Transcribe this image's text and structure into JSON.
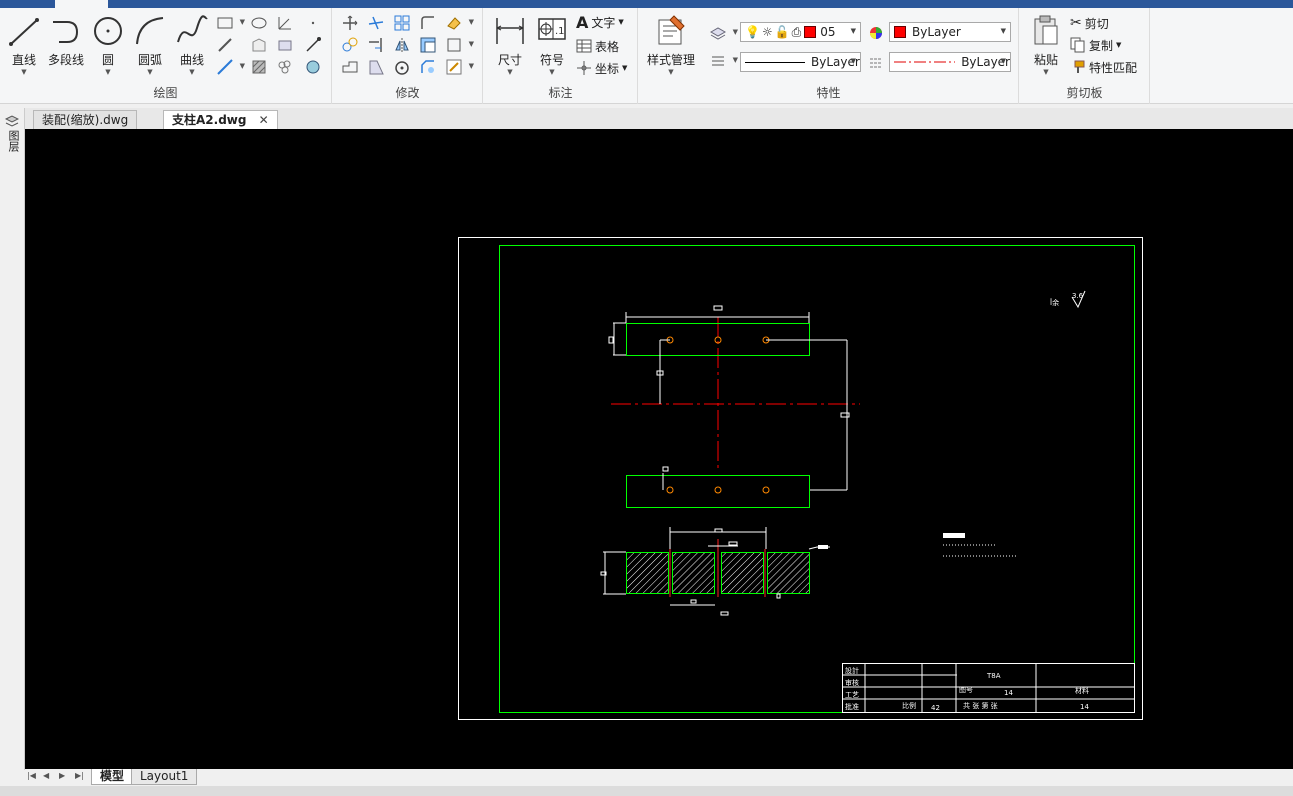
{
  "ribbon": {
    "draw": {
      "title": "绘图",
      "line": "直线",
      "polyline": "多段线",
      "circle": "圆",
      "arc": "圆弧",
      "spline": "曲线"
    },
    "modify": {
      "title": "修改"
    },
    "annotate": {
      "title": "标注",
      "dimension": "尺寸",
      "symbol": "符号",
      "text": "文字",
      "table": "表格",
      "coordinate": "坐标"
    },
    "properties": {
      "title": "特性",
      "style_manager": "样式管理",
      "layer_name": "05",
      "color_value": "ByLayer",
      "linetype_value": "ByLayer",
      "lineweight_value": "ByLayer"
    },
    "clipboard": {
      "title": "剪切板",
      "paste": "粘贴",
      "cut": "剪切",
      "copy": "复制",
      "match_properties": "特性匹配"
    }
  },
  "left_panel": {
    "label": "图层"
  },
  "doc_tabs": [
    {
      "label": "装配(缩放).dwg"
    },
    {
      "label": "支柱A2.dwg",
      "close": "✕"
    }
  ],
  "layout_tabs": [
    {
      "label": "模型"
    },
    {
      "label": "Layout1"
    }
  ],
  "drawing": {
    "title_block": {
      "material": "T8A",
      "c1": "14",
      "c2": "14",
      "c3": "42"
    }
  },
  "colors": {
    "ribbon_accent": "#2b579a",
    "canvas_bg": "#000000",
    "frame": "#ffffff",
    "border_green": "#00ff00",
    "centerline": "#ff0000",
    "hatch_fill": "#00aa00",
    "layer_color": "#ff0000"
  }
}
